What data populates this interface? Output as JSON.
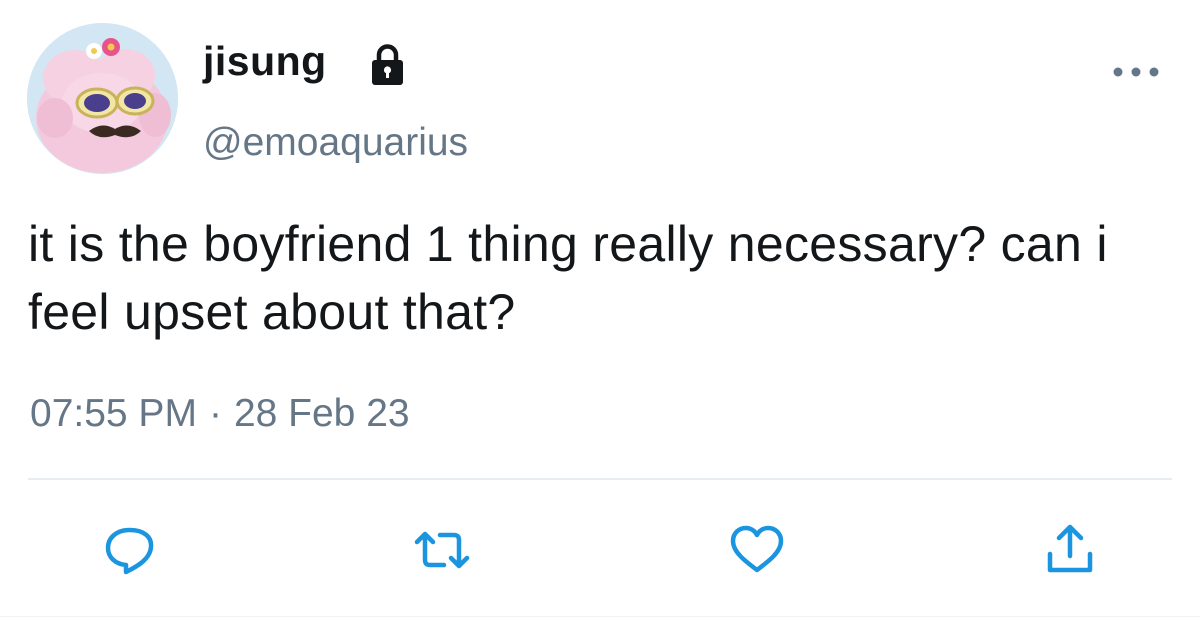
{
  "tweet": {
    "display_name": "jisung",
    "protected": true,
    "handle": "@emoaquarius",
    "text": "it is the boyfriend 1 thing really necessary? can i feel upset about that?",
    "time": "07:55 PM",
    "separator": "·",
    "date": "28 Feb 23"
  },
  "icons": {
    "lock": "lock-icon",
    "more": "more-horizontal-icon",
    "reply": "reply-icon",
    "retweet": "retweet-icon",
    "like": "heart-icon",
    "share": "share-icon"
  },
  "colors": {
    "text": "#14171a",
    "secondary": "#657786",
    "icon": "#1b95e0",
    "divider": "#e6ecf0"
  }
}
